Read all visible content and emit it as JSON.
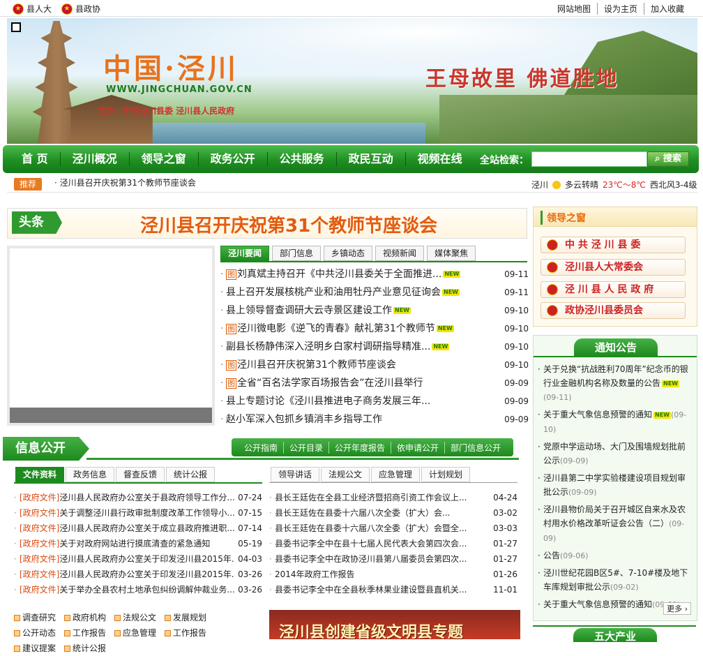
{
  "topbar": {
    "left": [
      "县人大",
      "县政协"
    ],
    "right": [
      "网站地图",
      "设为主页",
      "加入收藏"
    ]
  },
  "banner": {
    "title": "中国·泾川",
    "url": "WWW.JINGCHUAN.GOV.CN",
    "host": "主办：中共泾川县委 泾川县人民政府",
    "slogan": "王母故里 佛道胜地"
  },
  "nav": {
    "items": [
      "首 页",
      "泾川概况",
      "领导之窗",
      "政务公开",
      "公共服务",
      "政民互动",
      "视频在线"
    ],
    "search_label": "全站检索：",
    "search_value": "",
    "search_button": "搜索"
  },
  "ticker": {
    "tag": "推荐",
    "message": "· 泾川县召开庆祝第31个教师节座谈会",
    "weather_city": "泾川",
    "weather_cond": "多云转晴",
    "weather_temp": "23℃～8℃",
    "weather_wind": "西北风3-4级"
  },
  "headline": {
    "label": "头条",
    "text": "泾川县召开庆祝第31个教师节座谈会"
  },
  "news_tabs": [
    "泾川要闻",
    "部门信息",
    "乡镇动态",
    "视频新闻",
    "媒体聚焦"
  ],
  "news": [
    {
      "pic": true,
      "title": "刘真斌主持召开《中共泾川县委关于全面推进...",
      "new": true,
      "date": "09-11"
    },
    {
      "pic": false,
      "title": "县上召开发展核桃产业和油用牡丹产业意见征询会",
      "new": true,
      "date": "09-11"
    },
    {
      "pic": false,
      "title": "县上领导督查调研大云寺景区建设工作",
      "new": true,
      "date": "09-10"
    },
    {
      "pic": true,
      "title": "泾川微电影《逆飞的青春》献礼第31个教师节",
      "new": true,
      "date": "09-10"
    },
    {
      "pic": false,
      "title": "副县长杨静伟深入泾明乡白家村调研指导精准...",
      "new": true,
      "date": "09-10"
    },
    {
      "pic": true,
      "title": "泾川县召开庆祝第31个教师节座谈会",
      "new": false,
      "date": "09-10"
    },
    {
      "pic": true,
      "title": "全省“百名法学家百场报告会”在泾川县举行",
      "new": false,
      "date": "09-09"
    },
    {
      "pic": false,
      "title": "县上专题讨论《泾川县推进电子商务发展三年...",
      "new": false,
      "date": "09-09"
    },
    {
      "pic": false,
      "title": "赵小军深入包抓乡镇消丰乡指导工作",
      "new": false,
      "date": "09-09"
    }
  ],
  "pic_label": "图",
  "new_label": "NEW",
  "info": {
    "label": "信息公开",
    "links": [
      "公开指南",
      "公开目录",
      "公开年度报告",
      "依申请公开",
      "部门信息公开"
    ],
    "left_tabs": [
      "文件资料",
      "政务信息",
      "督查反馈",
      "统计公报"
    ],
    "right_tabs": [
      "领导讲话",
      "法规公文",
      "应急管理",
      "计划规划"
    ],
    "left_docs": [
      {
        "cat": "[政府文件]",
        "title": "泾川县人民政府办公室关于县政府领导工作分...",
        "date": "07-24"
      },
      {
        "cat": "[政府文件]",
        "title": "关于调整泾川县行政审批制度改革工作领导小...",
        "date": "07-15"
      },
      {
        "cat": "[政府文件]",
        "title": "泾川县人民政府办公室关于成立县政府推进职...",
        "date": "07-14"
      },
      {
        "cat": "[政府文件]",
        "title": "关于对政府网站进行摸底清查的紧急通知",
        "date": "05-19"
      },
      {
        "cat": "[政府文件]",
        "title": "泾川县人民政府办公室关于印发泾川县2015年...",
        "date": "04-03"
      },
      {
        "cat": "[政府文件]",
        "title": "泾川县人民政府办公室关于印发泾川县2015年...",
        "date": "03-26"
      },
      {
        "cat": "[政府文件]",
        "title": "关于举办全县农村土地承包纠纷调解仲裁业务...",
        "date": "03-26"
      }
    ],
    "right_docs": [
      {
        "title": "县长王廷佐在全县工业经济暨招商引资工作会议上...",
        "date": "04-24"
      },
      {
        "title": "县长王廷佐在县委十六届八次全委（扩大）会...",
        "date": "03-02"
      },
      {
        "title": "县长王廷佐在县委十六届八次全委（扩大）会暨全...",
        "date": "03-03"
      },
      {
        "title": "县委书记李全中在县十七届人民代表大会第四次会...",
        "date": "01-27"
      },
      {
        "title": "县委书记李全中在政协泾川县第八届委员会第四次...",
        "date": "01-27"
      },
      {
        "title": "2014年政府工作报告",
        "date": "01-26"
      },
      {
        "title": "县委书记李全中在全县秋季林果业建设暨县直机关...",
        "date": "11-01"
      }
    ]
  },
  "bottom_links": [
    "调查研究",
    "政府机构",
    "法规公文",
    "发展规划",
    "公开动态",
    "工作报告",
    "应急管理",
    "工作报告",
    "建议提案",
    "统计公报"
  ],
  "promo_text": "泾川县创建省级文明县专题",
  "leader_window": {
    "title": "领导之窗",
    "buttons": [
      "中 共 泾 川 县 委",
      "泾川县人大常委会",
      "泾 川 县 人 民 政 府",
      "政协泾川县委员会"
    ]
  },
  "notice": {
    "title": "通知公告",
    "items": [
      {
        "text": "关于兑换“抗战胜利70周年”纪念币的银行业金融机构名称及数量的公告",
        "new": true,
        "date": "(09-11)"
      },
      {
        "text": "关于重大气象信息预警的通知",
        "new": true,
        "date": "(09-10)"
      },
      {
        "text": "党原中学运动场、大门及围墙规划批前公示",
        "new": false,
        "date": "(09-09)"
      },
      {
        "text": "泾川县第二中学实验楼建设项目规划审批公示",
        "new": false,
        "date": "(09-09)"
      },
      {
        "text": "泾川县物价局关于召开城区自来水及农村用水价格改革听证会公告（二）",
        "new": false,
        "date": "(09-09)"
      },
      {
        "text": "公告",
        "new": false,
        "date": "(09-06)"
      },
      {
        "text": "泾川世纪花园B区5#、7-10#楼及地下车库规划审批公示",
        "new": false,
        "date": "(09-02)"
      },
      {
        "text": "关于重大气象信息预警的通知",
        "new": false,
        "date": "(09-01)"
      }
    ],
    "more": "更多"
  },
  "five_title": "五大产业"
}
